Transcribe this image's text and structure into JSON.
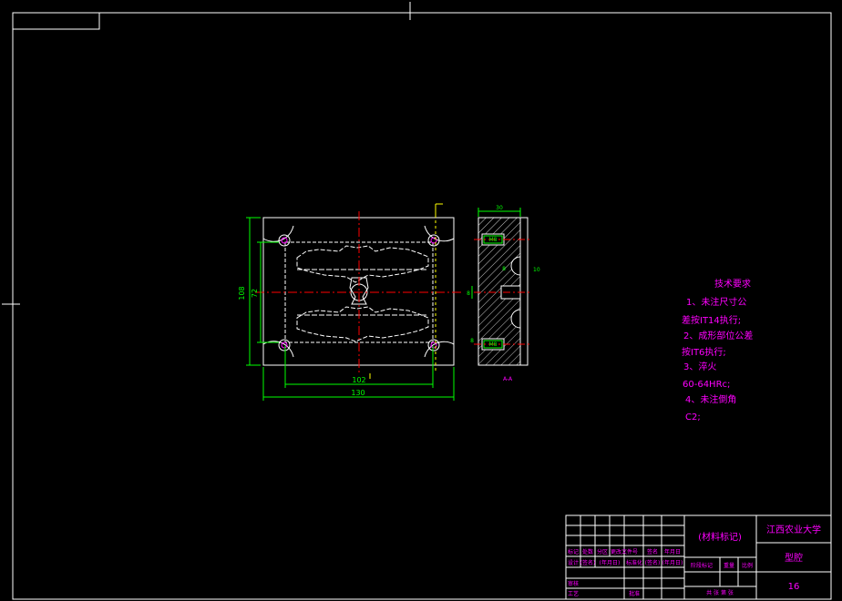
{
  "colors": {
    "background": "#000000",
    "frame": "#ffffff",
    "part": "#ffffff",
    "dimension": "#00ff00",
    "centerline": "#ff0000",
    "axis": "#ffff00",
    "text": "#ff00ff"
  },
  "dimensions": {
    "overall_width": "130",
    "inner_width": "102",
    "overall_height": "108",
    "inner_height": "72",
    "side_width": "30",
    "side_feature": "10",
    "side_hole_upper": "M8",
    "side_hole_lower": "M8",
    "side_mid": "8",
    "side_small_left": "8",
    "side_small_right": "8",
    "section_label": "A-A"
  },
  "tech_requirements": {
    "title": "技术要求",
    "lines": [
      "1、未注尺寸公",
      "差按IT14执行;",
      "2、成形部位公差",
      "按IT6执行;",
      "3、淬火",
      "60-64HRc;",
      "4、未注倒角",
      "C2;"
    ]
  },
  "title_block": {
    "material_mark": "(材料标记)",
    "school": "江西农业大学",
    "drawing_name": "型腔",
    "drawing_no": "16",
    "row_labels_1": [
      "标记",
      "处数",
      "分区",
      "更改文件号",
      "签名",
      "年月日"
    ],
    "row_labels_2": [
      "设计",
      "(签名)",
      "(年月日)",
      "标准化",
      "(签名)",
      "(年月日)"
    ],
    "stage_labels": [
      "阶段标记",
      "重量",
      "比例"
    ],
    "review_labels": [
      "审核",
      "工艺"
    ],
    "approve_label": "批准",
    "sheet_label": "共  张  第  张"
  }
}
